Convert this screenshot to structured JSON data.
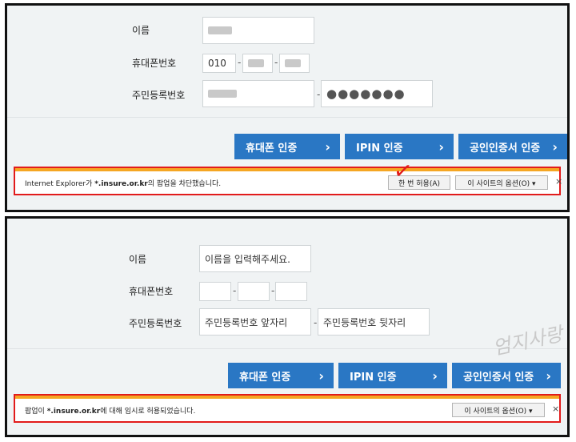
{
  "top": {
    "labels": {
      "name": "이름",
      "phone": "휴대폰번호",
      "resident": "주민등록번호"
    },
    "phone_prefix": "010",
    "resident_back_masked": "●●●●●●●",
    "buttons": {
      "phone_auth": "휴대폰 인증",
      "ipin_auth": "IPIN 인증",
      "cert_auth": "공인인증서 인증"
    },
    "notification": {
      "msg_prefix": "Internet Explorer가 ",
      "domain": "*.insure.or.kr",
      "msg_suffix": "의 팝업을 차단했습니다.",
      "allow_once": "한 번 허용(A)",
      "site_options": "이 사이트의 옵션(O) ▾",
      "close": "×"
    }
  },
  "bottom": {
    "labels": {
      "name": "이름",
      "phone": "휴대폰번호",
      "resident": "주민등록번호"
    },
    "placeholders": {
      "name": "이름을 입력해주세요.",
      "resident_front": "주민등록번호 앞자리",
      "resident_back": "주민등록번호 뒷자리"
    },
    "buttons": {
      "phone_auth": "휴대폰 인증",
      "ipin_auth": "IPIN 인증",
      "cert_auth": "공인인증서 인증"
    },
    "notification": {
      "msg_prefix": "팝업이 ",
      "domain": "*.insure.or.kr",
      "msg_suffix": "에 대해 임시로 허용되었습니다.",
      "site_options": "이 사이트의 옵션(O) ▾",
      "close": "×"
    }
  },
  "watermark": "엄지사랑",
  "dash": "-",
  "chevron": "›",
  "check_mark": "✓"
}
